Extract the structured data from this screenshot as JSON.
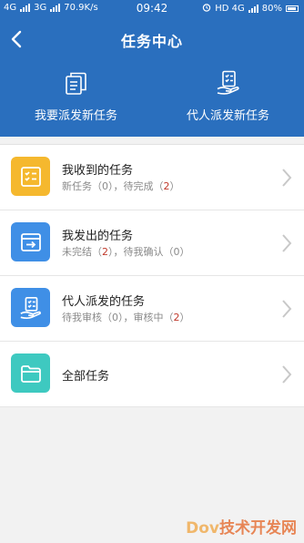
{
  "status_bar": {
    "net1": "4G",
    "net2": "3G",
    "speed": "70.9K/s",
    "time": "09:42",
    "net_right": "HD 4G",
    "battery": "80%"
  },
  "navbar": {
    "title": "任务中心"
  },
  "actions": [
    {
      "label": "我要派发新任务",
      "icon": "documents-icon"
    },
    {
      "label": "代人派发新任务",
      "icon": "hand-clipboard-icon"
    }
  ],
  "rows": [
    {
      "title": "我收到的任务",
      "sub": [
        {
          "text": "新任务（",
          "red": false
        },
        {
          "text": "0",
          "red": false
        },
        {
          "text": "），待完成（",
          "red": false
        },
        {
          "text": "2",
          "red": true
        },
        {
          "text": "）",
          "red": false
        }
      ],
      "icon": "checklist-icon",
      "color": "#f5b82e"
    },
    {
      "title": "我发出的任务",
      "sub": [
        {
          "text": "未完结（",
          "red": false
        },
        {
          "text": "2",
          "red": true
        },
        {
          "text": "），待我确认（",
          "red": false
        },
        {
          "text": "0",
          "red": false
        },
        {
          "text": "）",
          "red": false
        }
      ],
      "icon": "window-arrow-icon",
      "color": "#3f8fe6"
    },
    {
      "title": "代人派发的任务",
      "sub": [
        {
          "text": "待我审核（",
          "red": false
        },
        {
          "text": "0",
          "red": false
        },
        {
          "text": "），审核中（",
          "red": false
        },
        {
          "text": "2",
          "red": true
        },
        {
          "text": "）",
          "red": false
        }
      ],
      "icon": "hand-clipboard-icon",
      "color": "#3f8fe6"
    },
    {
      "title": "全部任务",
      "sub": [],
      "icon": "folder-icon",
      "color": "#3ec9c0"
    }
  ],
  "watermark": {
    "text1": "Dov",
    "text2": "技术开发网"
  },
  "colors": {
    "header": "#2a6fbe",
    "red_count": "#c0392b"
  }
}
